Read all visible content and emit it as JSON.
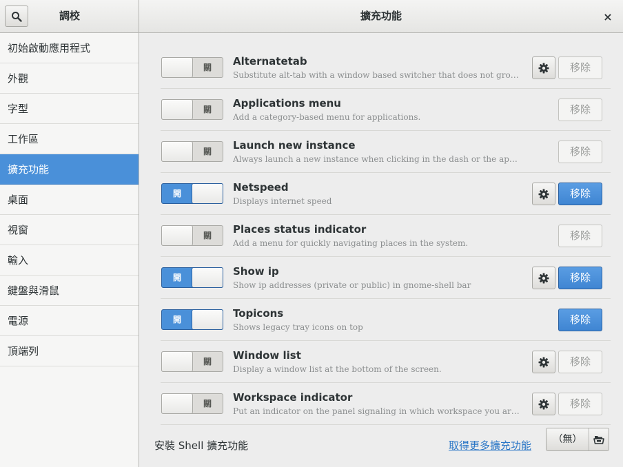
{
  "header": {
    "app_title": "調校",
    "page_title": "擴充功能",
    "close_glyph": "×"
  },
  "sidebar": {
    "items": [
      {
        "label": "初始啟動應用程式"
      },
      {
        "label": "外觀"
      },
      {
        "label": "字型"
      },
      {
        "label": "工作區"
      },
      {
        "label": "擴充功能",
        "selected": true
      },
      {
        "label": "桌面"
      },
      {
        "label": "視窗"
      },
      {
        "label": "輸入"
      },
      {
        "label": "鍵盤與滑鼠"
      },
      {
        "label": "電源"
      },
      {
        "label": "頂端列"
      }
    ]
  },
  "extensions": [
    {
      "name": "Alternatetab",
      "description": "Substitute alt-tab with a window based switcher that does not group by app…",
      "enabled": false,
      "state_label": "關",
      "has_settings": true,
      "remove_label": "移除"
    },
    {
      "name": "Applications menu",
      "description": "Add a category-based menu for applications.",
      "enabled": false,
      "state_label": "關",
      "has_settings": false,
      "remove_label": "移除"
    },
    {
      "name": "Launch new instance",
      "description": "Always launch a new instance when clicking in the dash or the application view.",
      "enabled": false,
      "state_label": "關",
      "has_settings": false,
      "remove_label": "移除"
    },
    {
      "name": "Netspeed",
      "description": "Displays internet speed",
      "enabled": true,
      "state_label": "開",
      "has_settings": true,
      "remove_label": "移除"
    },
    {
      "name": "Places status indicator",
      "description": "Add a menu for quickly navigating places in the system.",
      "enabled": false,
      "state_label": "關",
      "has_settings": false,
      "remove_label": "移除"
    },
    {
      "name": "Show ip",
      "description": "Show ip addresses (private or public) in gnome-shell bar",
      "enabled": true,
      "state_label": "開",
      "has_settings": true,
      "remove_label": "移除"
    },
    {
      "name": "Topicons",
      "description": "Shows legacy tray icons on top",
      "enabled": true,
      "state_label": "開",
      "has_settings": false,
      "remove_label": "移除"
    },
    {
      "name": "Window list",
      "description": "Display a window list at the bottom of the screen.",
      "enabled": false,
      "state_label": "關",
      "has_settings": true,
      "remove_label": "移除"
    },
    {
      "name": "Workspace indicator",
      "description": "Put an indicator on the panel signaling in which workspace you are, and give…",
      "enabled": false,
      "state_label": "關",
      "has_settings": true,
      "remove_label": "移除"
    }
  ],
  "footer": {
    "install_label": "安裝 Shell 擴充功能",
    "more_link": "取得更多擴充功能",
    "file_chooser_label": "（無）"
  },
  "colors": {
    "accent": "#4a90d9",
    "link": "#2a76c6"
  }
}
